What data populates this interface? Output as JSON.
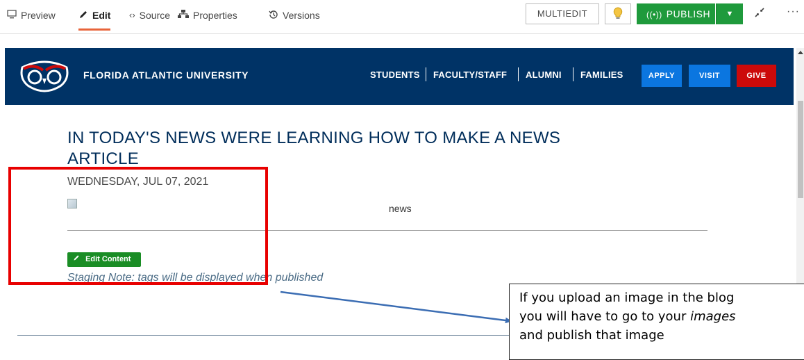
{
  "toolbar": {
    "tabs": [
      {
        "label": "Preview",
        "icon": "monitor-icon"
      },
      {
        "label": "Edit",
        "icon": "pencil-icon"
      },
      {
        "label": "Source",
        "icon": "code-icon"
      },
      {
        "label": "Properties",
        "icon": "sitemap-icon"
      },
      {
        "label": "Versions",
        "icon": "history-icon"
      }
    ],
    "multiedit_label": "MULTIEDIT",
    "publish_label": "PUBLISH",
    "more_label": "···"
  },
  "site": {
    "university_name": "FLORIDA ATLANTIC UNIVERSITY",
    "nav": [
      "STUDENTS",
      "FACULTY/STAFF",
      "ALUMNI",
      "FAMILIES"
    ],
    "cta": [
      {
        "label": "APPLY",
        "color": "#0b76e0"
      },
      {
        "label": "VISIT",
        "color": "#0b76e0"
      },
      {
        "label": "GIVE",
        "color": "#cc0a0a"
      }
    ],
    "header_color": "#003366"
  },
  "article": {
    "title_line1": "IN TODAY'S NEWS WERE LEARNING HOW TO MAKE A NEWS",
    "title_line2": "ARTICLE",
    "date": "WEDNESDAY, JUL 07, 2021",
    "image_alt": "news",
    "edit_button": "Edit Content",
    "staging_note": "Staging Note: tags will be displayed when published"
  },
  "annotation": {
    "line1": "If you upload an image in the blog",
    "line2_prefix": "you will have to go to your ",
    "line2_italic": "images",
    "line3": "and publish that image"
  }
}
